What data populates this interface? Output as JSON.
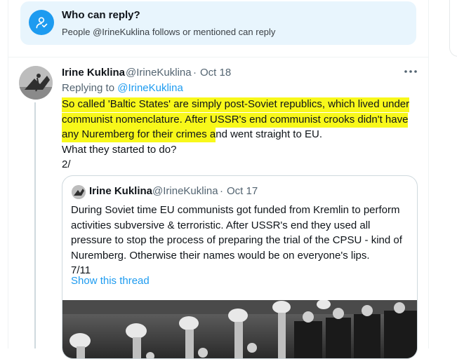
{
  "colors": {
    "accent": "#1d9bf0",
    "highlight": "#f8f81a",
    "banner_bg": "#e8f5fd",
    "muted": "#536471"
  },
  "reply_banner": {
    "icon": "user-mention-icon",
    "title": "Who can reply?",
    "subtitle": "People @IrineKuklina follows or mentioned can reply"
  },
  "tweet": {
    "author_name": "Irine Kuklina",
    "handle": "@IrineKuklina",
    "separator": "·",
    "date": "Oct 18",
    "replying_prefix": "Replying to",
    "replying_handle": "@IrineKuklina",
    "more_icon": "more-horizontal-icon",
    "lines": [
      {
        "hl": "So called 'Baltic States' are simply post-Soviet republics, which lived under"
      },
      {
        "hl": "communist nomenclature. After USSR's end communist crooks didn't have"
      },
      {
        "hl": "any Nuremberg for their crimes a",
        "rest": "nd went straight to EU."
      },
      {
        "rest": "What they started to do?"
      },
      {
        "rest": "2/"
      }
    ]
  },
  "quote": {
    "author_name": "Irine Kuklina",
    "handle": "@IrineKuklina",
    "separator": "·",
    "date": "Oct 17",
    "lines": [
      "During Soviet time EU communists got funded from Kremlin to perform",
      "activities subversive & terroristic. After USSR's end they used all",
      "pressure to stop the process of preparing the trial of the CPSU - kind of",
      "Nuremberg. Otherwise their names would be on everyone's lips.",
      "7/11"
    ],
    "show_thread": "Show this thread"
  }
}
